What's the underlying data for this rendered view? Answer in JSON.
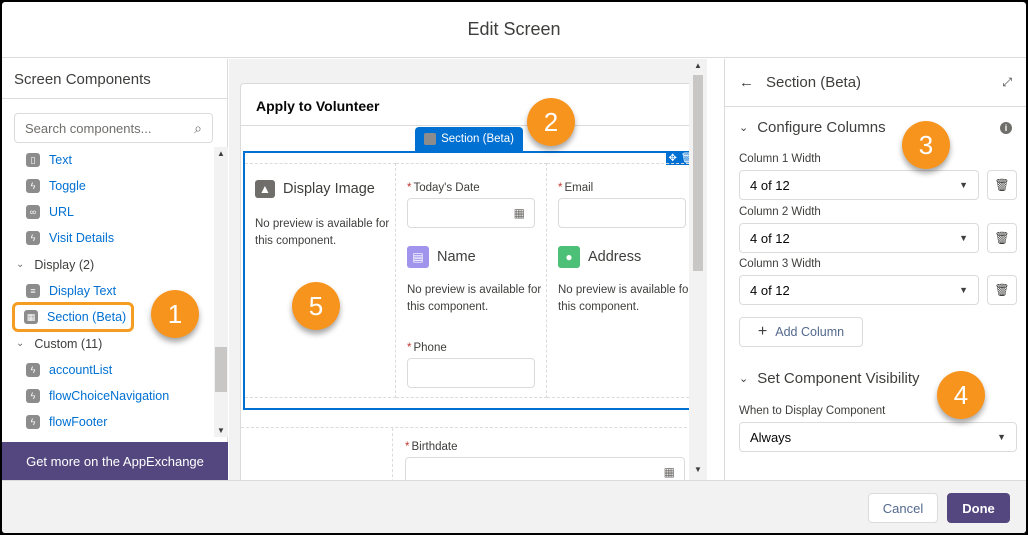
{
  "header": {
    "title": "Edit Screen"
  },
  "left_panel": {
    "title": "Screen Components",
    "search_placeholder": "Search components...",
    "items_top": [
      {
        "label": "Text",
        "icon": "text-icon"
      },
      {
        "label": "Toggle",
        "icon": "lightning-icon"
      },
      {
        "label": "URL",
        "icon": "link-icon"
      },
      {
        "label": "Visit Details",
        "icon": "lightning-icon"
      }
    ],
    "group_display": "Display (2)",
    "items_display": [
      {
        "label": "Display Text",
        "icon": "display-text-icon"
      },
      {
        "label": "Section (Beta)",
        "icon": "section-icon"
      }
    ],
    "group_custom": "Custom (11)",
    "items_custom": [
      {
        "label": "accountList",
        "icon": "lightning-icon"
      },
      {
        "label": "flowChoiceNavigation",
        "icon": "lightning-icon"
      },
      {
        "label": "flowFooter",
        "icon": "lightning-icon"
      }
    ],
    "appexchange": "Get more on the AppExchange"
  },
  "canvas": {
    "screen_title": "Apply to Volunteer",
    "section_tab": "Section (Beta)",
    "col1": {
      "component": "Display Image",
      "no_preview": "No preview is available for this component."
    },
    "col2": {
      "date_label": "Today's Date",
      "name_component": "Name",
      "no_preview": "No preview is available for this component.",
      "phone_label": "Phone"
    },
    "col3": {
      "email_label": "Email",
      "address_component": "Address",
      "no_preview": "No preview is available for this component."
    },
    "row2": {
      "birthdate_label": "Birthdate"
    },
    "required_marker": "*"
  },
  "right_panel": {
    "title": "Section (Beta)",
    "configure_columns": "Configure Columns",
    "columns": [
      {
        "label": "Column 1 Width",
        "value": "4 of 12"
      },
      {
        "label": "Column 2 Width",
        "value": "4 of 12"
      },
      {
        "label": "Column 3 Width",
        "value": "4 of 12"
      }
    ],
    "add_column": "Add Column",
    "visibility_heading": "Set Component Visibility",
    "visibility_label": "When to Display Component",
    "visibility_value": "Always"
  },
  "footer": {
    "cancel": "Cancel",
    "done": "Done"
  },
  "callouts": [
    "1",
    "2",
    "3",
    "4",
    "5"
  ],
  "colors": {
    "brand_blue": "#0070d2",
    "callout_orange": "#f7941d",
    "done_purple": "#54477f"
  }
}
